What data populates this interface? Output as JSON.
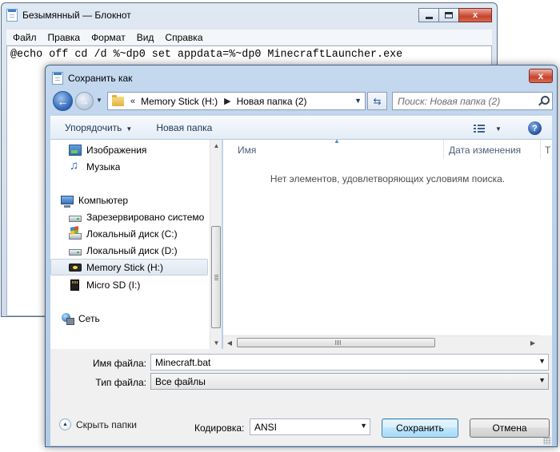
{
  "notepad": {
    "title": "Безымянный — Блокнот",
    "menu": [
      "Файл",
      "Правка",
      "Формат",
      "Вид",
      "Справка"
    ],
    "content": "@echo off cd /d %~dp0 set appdata=%~dp0 MinecraftLauncher.exe"
  },
  "dialog": {
    "title": "Сохранить как",
    "close_label": "x",
    "address": {
      "overflow": "«",
      "segments": [
        "Memory Stick (H:)",
        "Новая папка (2)"
      ]
    },
    "search_placeholder": "Поиск: Новая папка (2)",
    "commands": {
      "organize": "Упорядочить",
      "new_folder": "Новая папка"
    },
    "nav_pane": {
      "items": [
        {
          "label": "Изображения",
          "icon": "pictures-icon"
        },
        {
          "label": "Музыка",
          "icon": "music-icon"
        },
        {
          "label": "Компьютер",
          "icon": "computer-icon"
        },
        {
          "label": "Зарезервировано системо",
          "icon": "drive-icon"
        },
        {
          "label": "Локальный диск (C:)",
          "icon": "windows-drive-icon"
        },
        {
          "label": "Локальный диск (D:)",
          "icon": "drive-icon"
        },
        {
          "label": "Memory Stick (H:)",
          "icon": "memory-stick-icon",
          "selected": true
        },
        {
          "label": "Micro SD (I:)",
          "icon": "sd-card-icon"
        },
        {
          "label": "Сеть",
          "icon": "network-icon"
        }
      ]
    },
    "columns": [
      "Имя",
      "Дата изменения",
      "Т"
    ],
    "empty_message": "Нет элементов, удовлетворяющих условиям поиска.",
    "filename_label": "Имя файла:",
    "filename_value": "Minecraft.bat",
    "filetype_label": "Тип файла:",
    "filetype_value": "Все файлы",
    "hide_folders": "Скрыть папки",
    "encoding_label": "Кодировка:",
    "encoding_value": "ANSI",
    "save_button": "Сохранить",
    "cancel_button": "Отмена"
  },
  "colors": {
    "dialog_frame": "#b2cbe6",
    "selected_row": "#dfe7f1",
    "default_button": "#bee6fd"
  }
}
